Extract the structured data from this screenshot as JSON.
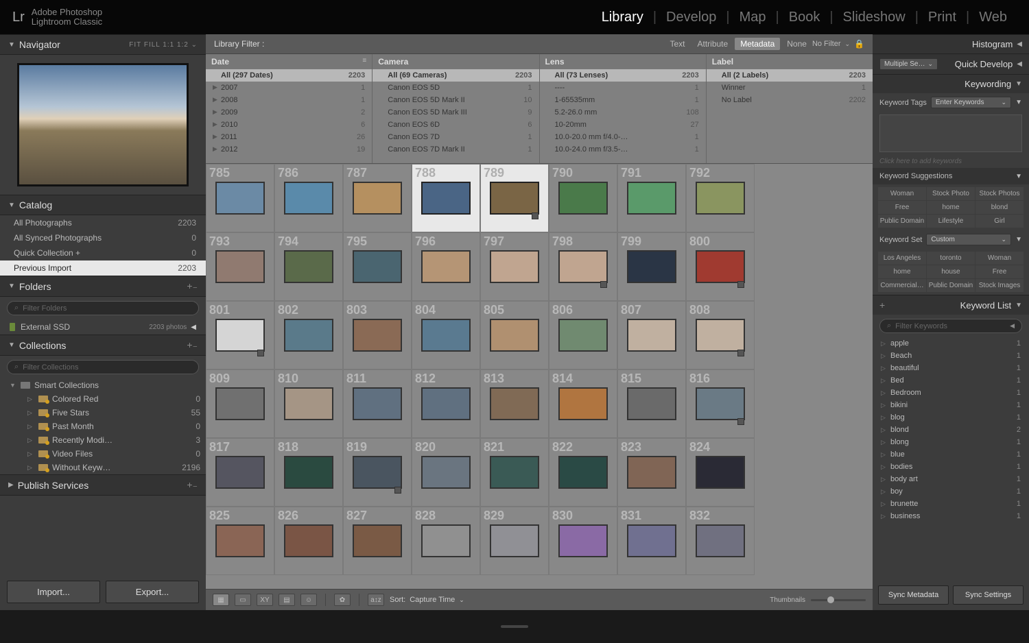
{
  "app": {
    "brand": "Adobe Photoshop",
    "product": "Lightroom Classic",
    "logo": "Lr"
  },
  "modules": [
    "Library",
    "Develop",
    "Map",
    "Book",
    "Slideshow",
    "Print",
    "Web"
  ],
  "activeModule": "Library",
  "navigator": {
    "title": "Navigator",
    "opts": "FIT   FILL   1:1   1:2  ⌄"
  },
  "catalog": {
    "title": "Catalog",
    "items": [
      {
        "label": "All Photographs",
        "count": 2203
      },
      {
        "label": "All Synced Photographs",
        "count": 0
      },
      {
        "label": "Quick Collection  +",
        "count": 0
      },
      {
        "label": "Previous Import",
        "count": 2203,
        "sel": true
      }
    ]
  },
  "folders": {
    "title": "Folders",
    "filter_ph": "Filter Folders",
    "drive": "External SSD",
    "drive_count": "2203 photos"
  },
  "collections": {
    "title": "Collections",
    "filter_ph": "Filter Collections",
    "root": "Smart Collections",
    "items": [
      {
        "label": "Colored Red",
        "count": 0
      },
      {
        "label": "Five Stars",
        "count": 55
      },
      {
        "label": "Past Month",
        "count": 0
      },
      {
        "label": "Recently Modi…",
        "count": 3
      },
      {
        "label": "Video Files",
        "count": 0
      },
      {
        "label": "Without Keyw…",
        "count": 2196
      }
    ]
  },
  "publish": {
    "title": "Publish Services"
  },
  "buttons": {
    "import": "Import...",
    "export": "Export..."
  },
  "libfilter": {
    "label": "Library Filter :",
    "tabs": [
      "Text",
      "Attribute",
      "Metadata",
      "None"
    ],
    "active": "Metadata",
    "nofilter": "No Filter"
  },
  "metadata": {
    "date": {
      "head": "Date",
      "all": "All (297 Dates)",
      "allcount": 2203,
      "rows": [
        {
          "label": "2007",
          "count": 1
        },
        {
          "label": "2008",
          "count": 1
        },
        {
          "label": "2009",
          "count": 2
        },
        {
          "label": "2010",
          "count": 6
        },
        {
          "label": "2011",
          "count": 26
        },
        {
          "label": "2012",
          "count": 19
        }
      ]
    },
    "camera": {
      "head": "Camera",
      "all": "All (69 Cameras)",
      "allcount": 2203,
      "rows": [
        {
          "label": "Canon EOS 5D",
          "count": 1
        },
        {
          "label": "Canon EOS 5D Mark II",
          "count": 10
        },
        {
          "label": "Canon EOS 5D Mark III",
          "count": 9
        },
        {
          "label": "Canon EOS 6D",
          "count": 6
        },
        {
          "label": "Canon EOS 7D",
          "count": 1
        },
        {
          "label": "Canon EOS 7D Mark II",
          "count": 1
        }
      ]
    },
    "lens": {
      "head": "Lens",
      "all": "All (73 Lenses)",
      "allcount": 2203,
      "rows": [
        {
          "label": "----",
          "count": 1
        },
        {
          "label": "1-65535mm",
          "count": 1
        },
        {
          "label": "5.2-26.0 mm",
          "count": 108
        },
        {
          "label": "10-20mm",
          "count": 27
        },
        {
          "label": "10.0-20.0 mm f/4.0-…",
          "count": 1
        },
        {
          "label": "10.0-24.0 mm f/3.5-…",
          "count": 1
        }
      ]
    },
    "label": {
      "head": "Label",
      "all": "All (2 Labels)",
      "allcount": 2203,
      "rows": [
        {
          "label": "Winner",
          "count": 1
        },
        {
          "label": "No Label",
          "count": 2202
        }
      ]
    }
  },
  "grid": {
    "start": 785,
    "selected": [
      788,
      789
    ],
    "badges": [
      789,
      798,
      800,
      801,
      808,
      816,
      819
    ]
  },
  "toolbar": {
    "sort_label": "Sort:",
    "sort_value": "Capture Time",
    "thumb_label": "Thumbnails"
  },
  "rightpanels": {
    "histogram": "Histogram",
    "quickdev": {
      "title": "Quick Develop",
      "selector": "Multiple Se…"
    },
    "keywording": {
      "title": "Keywording",
      "tags_label": "Keyword Tags",
      "tags_dd": "Enter Keywords",
      "hint": "Click here to add keywords",
      "sugg_title": "Keyword Suggestions",
      "sugg": [
        "Woman",
        "Stock Photo",
        "Stock Photos",
        "Free",
        "home",
        "blond",
        "Public Domain",
        "Lifestyle",
        "Girl"
      ],
      "set_label": "Keyword Set",
      "set_dd": "Custom",
      "set": [
        "Los Angeles",
        "toronto",
        "Woman",
        "home",
        "house",
        "Free",
        "Commercial…",
        "Public Domain",
        "Stock Images"
      ]
    },
    "keywordlist": {
      "title": "Keyword List",
      "filter_ph": "Filter Keywords",
      "items": [
        {
          "label": "apple",
          "count": 1
        },
        {
          "label": "Beach",
          "count": 1
        },
        {
          "label": "beautiful",
          "count": 1
        },
        {
          "label": "Bed",
          "count": 1
        },
        {
          "label": "Bedroom",
          "count": 1
        },
        {
          "label": "bikini",
          "count": 1
        },
        {
          "label": "blog",
          "count": 1
        },
        {
          "label": "blond",
          "count": 2
        },
        {
          "label": "blong",
          "count": 1
        },
        {
          "label": "blue",
          "count": 1
        },
        {
          "label": "bodies",
          "count": 1
        },
        {
          "label": "body art",
          "count": 1
        },
        {
          "label": "boy",
          "count": 1
        },
        {
          "label": "brunette",
          "count": 1
        },
        {
          "label": "business",
          "count": 1
        }
      ]
    },
    "sync_meta": "Sync Metadata",
    "sync_set": "Sync Settings"
  },
  "thumb_colors": [
    [
      "#6b8aa5",
      "#5a8aaa",
      "#b59060",
      "#4a6585",
      "#7a6545",
      "#4a7a4a",
      "#5a9a6a",
      "#8a9560"
    ],
    [
      "#907a70",
      "#5a6a4a",
      "#4a6570",
      "#b59575",
      "#c0a590",
      "#c0a590",
      "#2a3545",
      "#a03a30"
    ],
    [
      "#d5d5d5",
      "#5a7a8a",
      "#8a6a55",
      "#5a7a90",
      "#b09070",
      "#708a70",
      "#c0b0a0",
      "#c0b0a0"
    ],
    [
      "#707070",
      "#a59585",
      "#607080",
      "#607080",
      "#806a55",
      "#b07540",
      "#6a6a6a",
      "#6a7a85"
    ],
    [
      "#555560",
      "#2a4a40",
      "#4a5560",
      "#6a7580",
      "#3a5a55",
      "#2a4a45",
      "#806555",
      "#2a2a35"
    ],
    [
      "#8a6555",
      "#7a5545",
      "#7a5a45",
      "#909090",
      "#909095",
      "#8a6aa5",
      "#707090",
      "#707080"
    ]
  ]
}
